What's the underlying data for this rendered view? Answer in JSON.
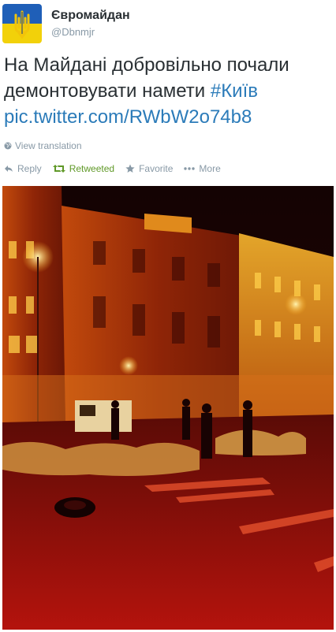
{
  "user": {
    "display_name": "Євромайдан",
    "handle": "@Dbnmjr",
    "avatar_icon": "ukraine-trident-flag-icon",
    "avatar_colors": {
      "blue": "#1f5fb8",
      "yellow": "#f2d10a"
    }
  },
  "tweet": {
    "text": "На Майдані добровільно почали демонтовувати намети",
    "hashtag": "#Київ",
    "link": "pic.twitter.com/RWbW2o74b8"
  },
  "translation": {
    "label": "View translation",
    "icon": "globe-icon"
  },
  "actions": [
    {
      "label": "Reply",
      "icon": "reply-icon"
    },
    {
      "label": "Retweeted",
      "icon": "retweet-icon",
      "active_color": "#609928"
    },
    {
      "label": "Favorite",
      "icon": "star-icon"
    },
    {
      "label": "More",
      "icon": "more-dots-icon"
    }
  ],
  "photo": {
    "subject": "night-street-photo"
  },
  "colors": {
    "link": "#2b7bb9",
    "muted": "#8899a6",
    "text": "#292f33"
  }
}
